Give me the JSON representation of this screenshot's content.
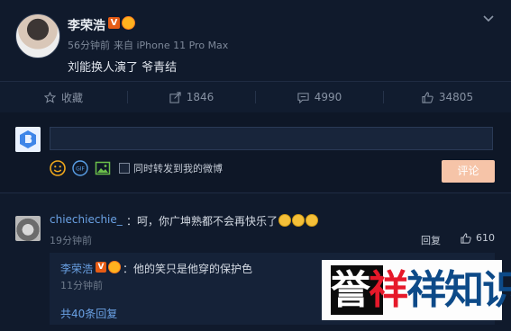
{
  "post": {
    "author": "李荣浩",
    "verified_mark": "V",
    "time": "56分钟前",
    "source": "来自 iPhone 11 Pro Max",
    "content": "刘能换人演了 爷青结"
  },
  "actions": {
    "favorite": "收藏",
    "repost_count": "1846",
    "comment_count": "4990",
    "like_count": "34805"
  },
  "compose": {
    "input_value": "",
    "repost_label": "同时转发到我的微博",
    "submit_label": "评论"
  },
  "comment": {
    "user": "chiechiechie_",
    "text": "：呵，你广坤熟都不会再快乐了",
    "time": "19分钟前",
    "reply_label": "回复",
    "like_count": "610"
  },
  "sub_reply": {
    "user": "李荣浩",
    "verified_mark": "V",
    "text": "：他的笑只是他穿的保护色",
    "time": "11分钟前",
    "total_label": "共40条回复"
  },
  "watermark": {
    "chars": [
      "誉",
      "祥",
      "祥",
      "知",
      "识"
    ]
  },
  "colors": {
    "background": "#0f1829",
    "link": "#6aa1e4",
    "accent": "#e65c15",
    "submit": "#f6c4a8"
  }
}
